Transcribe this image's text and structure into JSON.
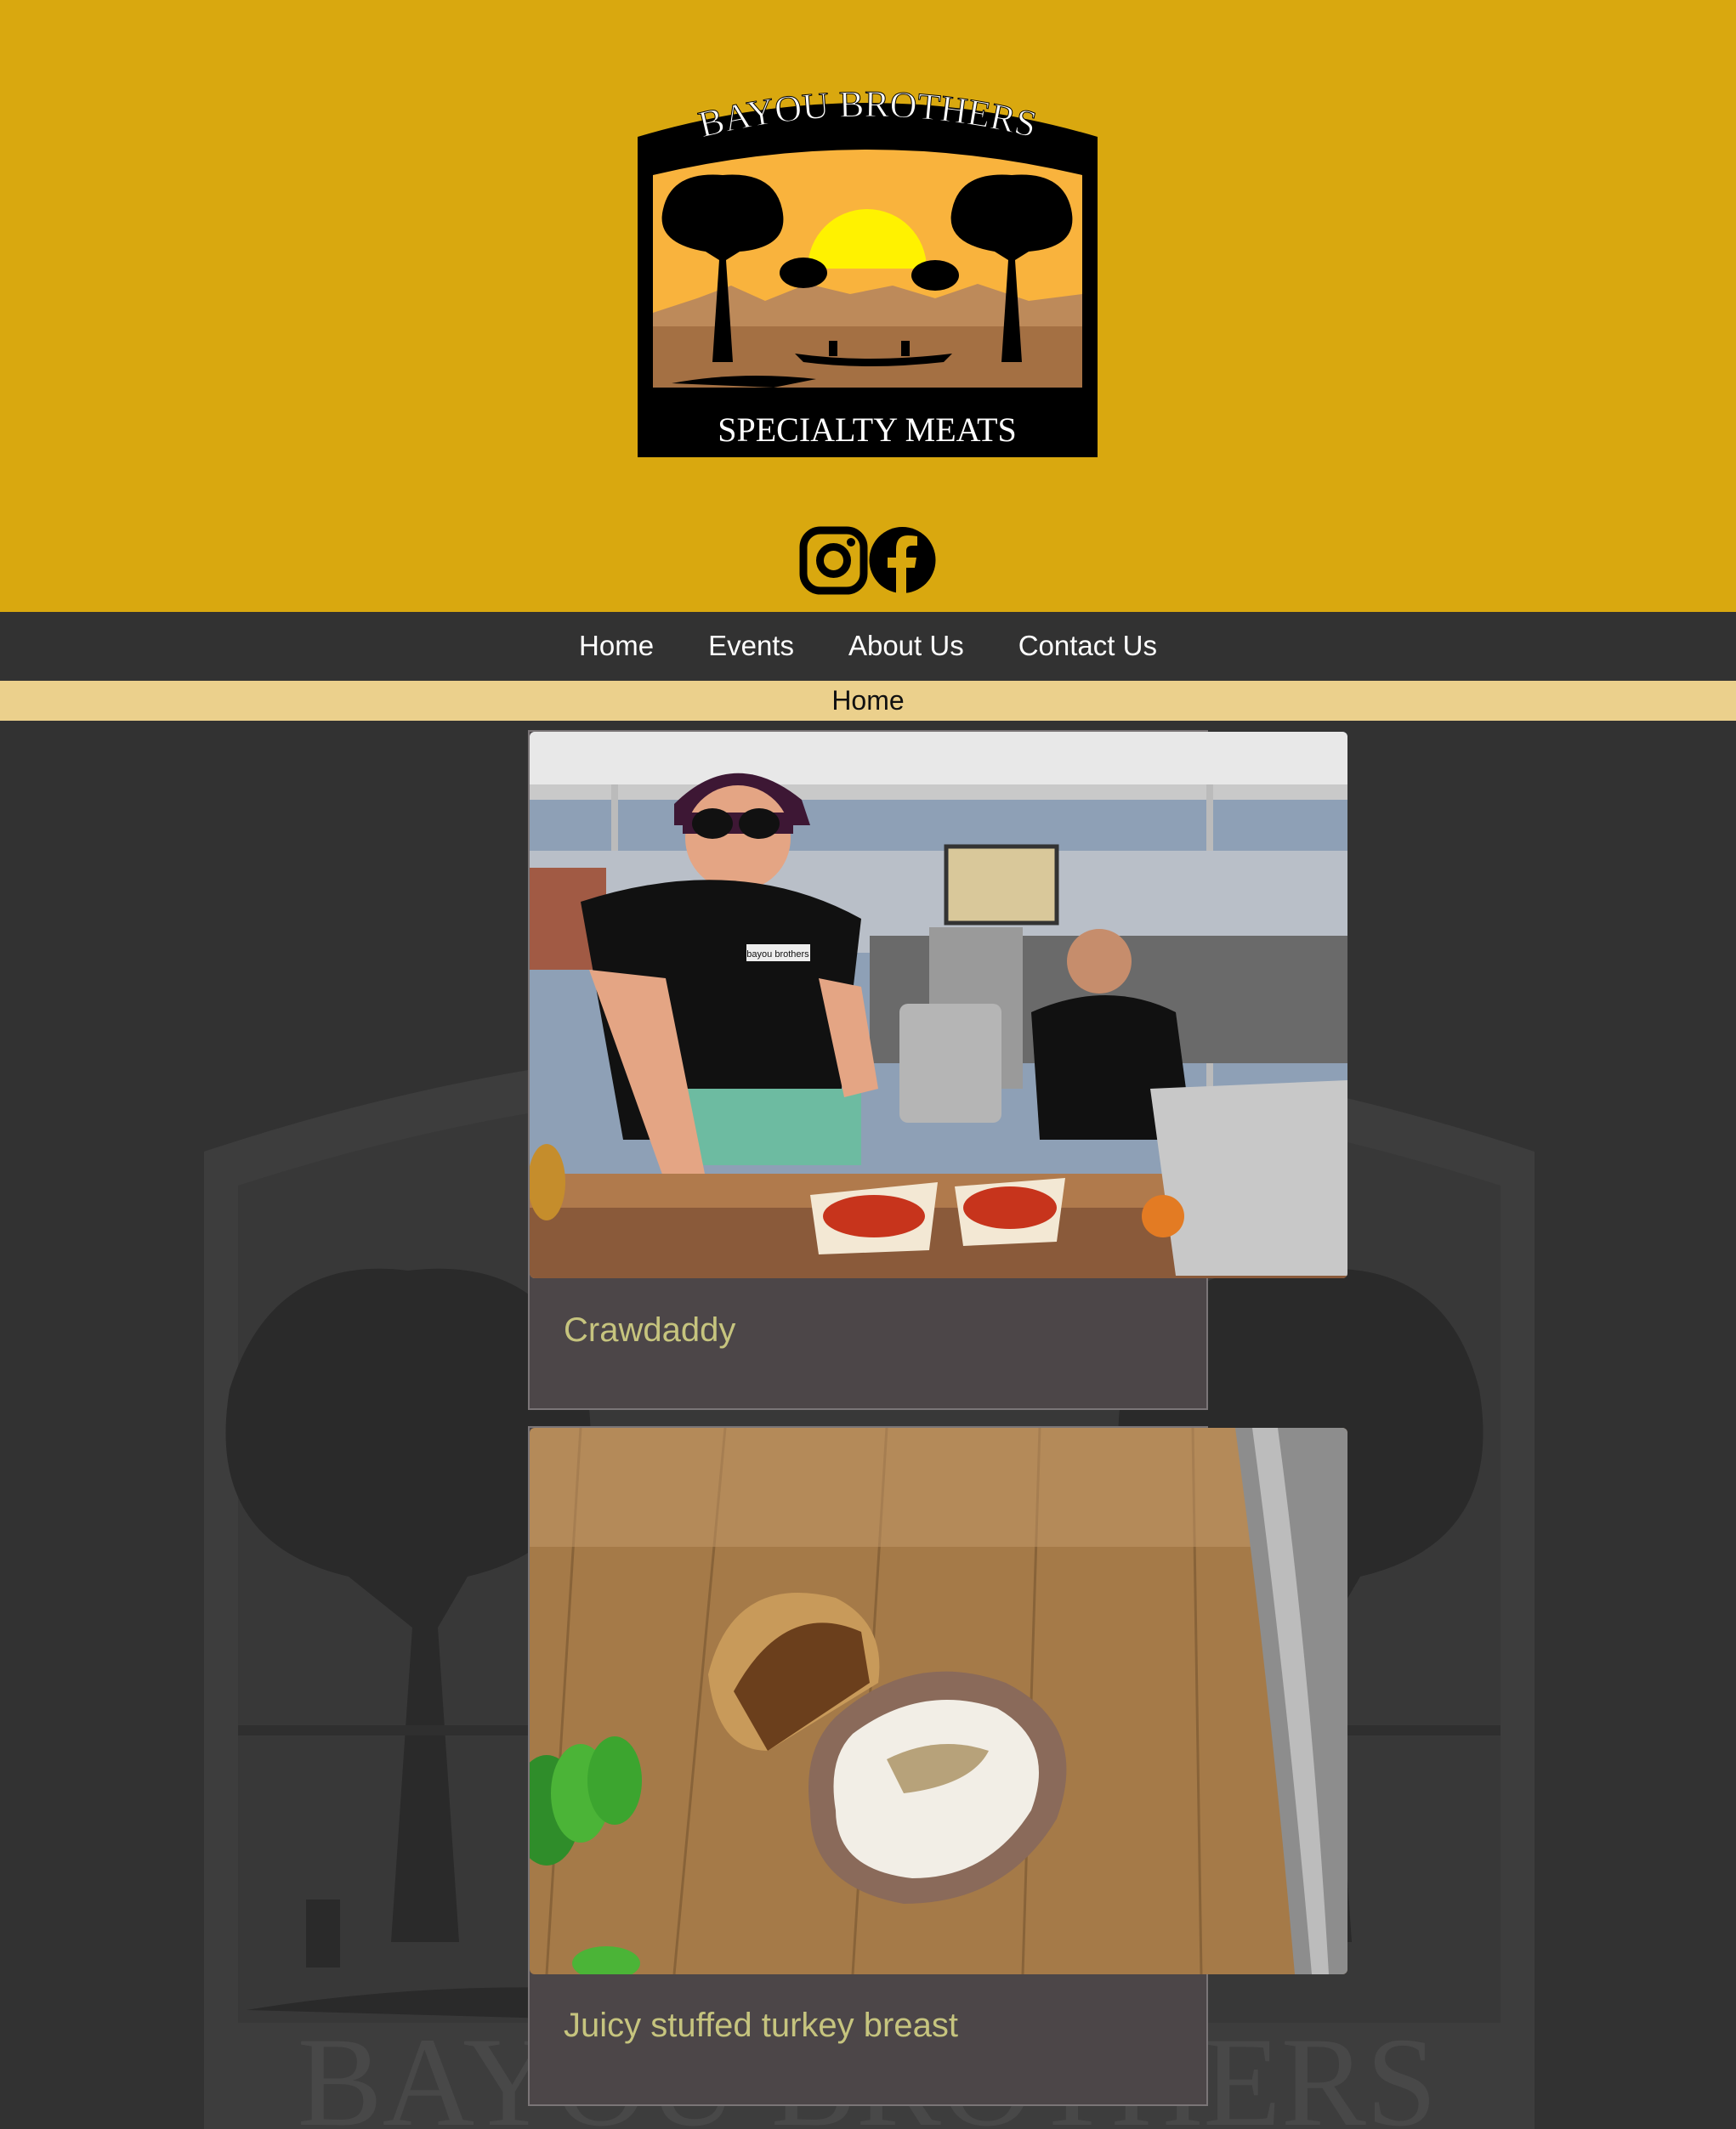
{
  "header": {
    "logo": {
      "top_text": "BAYOU BROTHERS",
      "bottom_text": "SPECIALTY MEATS"
    },
    "social": [
      {
        "icon": "instagram-icon"
      },
      {
        "icon": "facebook-icon"
      }
    ]
  },
  "nav": {
    "items": [
      {
        "label": "Home"
      },
      {
        "label": "Events"
      },
      {
        "label": "About Us"
      },
      {
        "label": "Contact Us"
      }
    ]
  },
  "breadcrumb": {
    "current": "Home"
  },
  "posts": [
    {
      "title": "Crawdaddy",
      "shirt_text": "bayou brothers"
    },
    {
      "title": "Juicy stuffed turkey breast"
    }
  ],
  "colors": {
    "header_bg": "#d9a80f",
    "page_bg": "#323232",
    "breadcrumb_bg": "#ebd08c",
    "card_bg": "#4c4648",
    "card_title": "#c6c47e"
  },
  "watermark": {
    "text": "BAYOU BROTHERS"
  }
}
